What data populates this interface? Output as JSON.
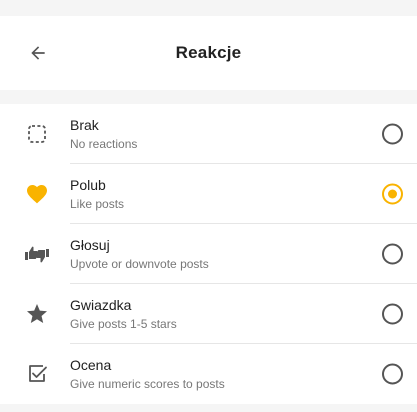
{
  "header": {
    "title": "Reakcje"
  },
  "accent_color": "#f9b300",
  "options": [
    {
      "icon": "dashed-square-icon",
      "title": "Brak",
      "subtitle": "No reactions",
      "selected": false
    },
    {
      "icon": "heart-icon",
      "title": "Polub",
      "subtitle": "Like posts",
      "selected": true
    },
    {
      "icon": "thumbs-up-down-icon",
      "title": "Głosuj",
      "subtitle": "Upvote or downvote posts",
      "selected": false
    },
    {
      "icon": "star-icon",
      "title": "Gwiazdka",
      "subtitle": "Give posts 1-5 stars",
      "selected": false
    },
    {
      "icon": "checkbox-icon",
      "title": "Ocena",
      "subtitle": "Give numeric scores to posts",
      "selected": false
    }
  ]
}
